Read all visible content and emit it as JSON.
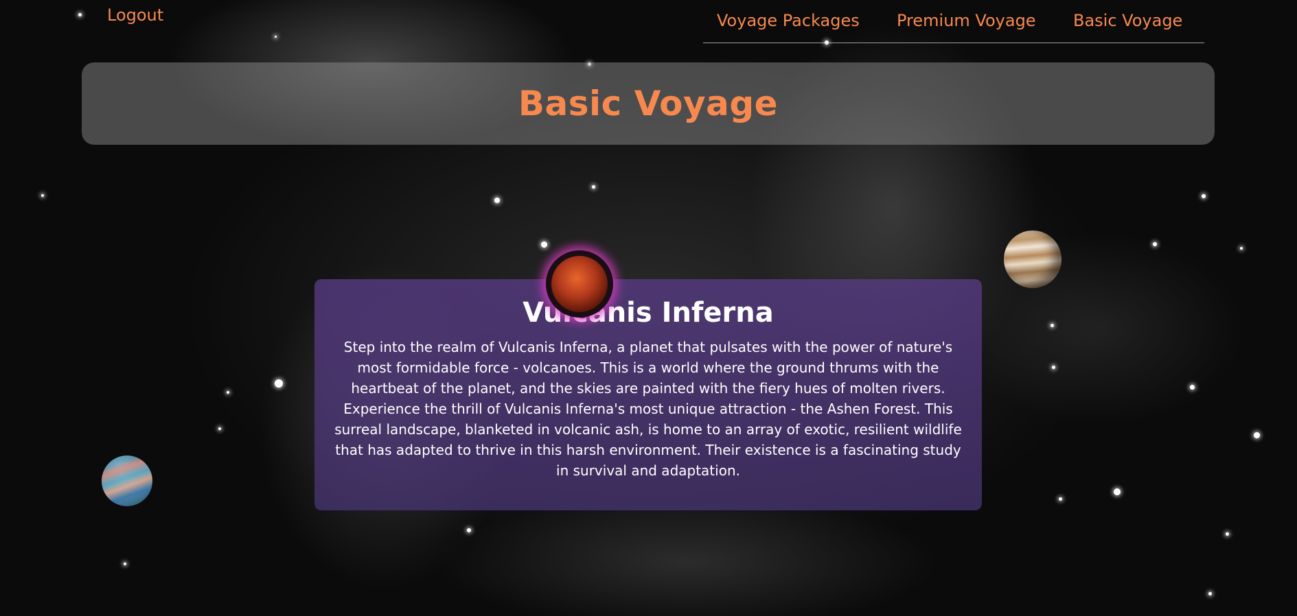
{
  "header": {
    "logout_label": "Logout"
  },
  "nav": {
    "items": [
      {
        "label": "Voyage Packages"
      },
      {
        "label": "Premium Voyage"
      },
      {
        "label": "Basic Voyage"
      }
    ]
  },
  "page": {
    "title": "Basic Voyage"
  },
  "planet": {
    "name": "Vulcanis Inferna",
    "description": "Step into the realm of Vulcanis Inferna, a planet that pulsates with the power of nature's most formidable force - volcanoes. This is a world where the ground thrums with the heartbeat of the planet, and the skies are painted with the fiery hues of molten rivers. Experience the thrill of Vulcanis Inferna's most unique attraction - the Ashen Forest. This surreal landscape, blanketed in volcanic ash, is home to an array of exotic, resilient wildlife that has adapted to thrive in this harsh environment. Their existence is a fascinating study in survival and adaptation."
  },
  "colors": {
    "accent": "#f7894f",
    "card_background": "#563a80",
    "planet_glow": "#d63cbe"
  },
  "icons": {
    "main_planet": "red-planet-icon",
    "left_planet": "blue-planet-icon",
    "right_planet": "gas-giant-planet-icon"
  }
}
